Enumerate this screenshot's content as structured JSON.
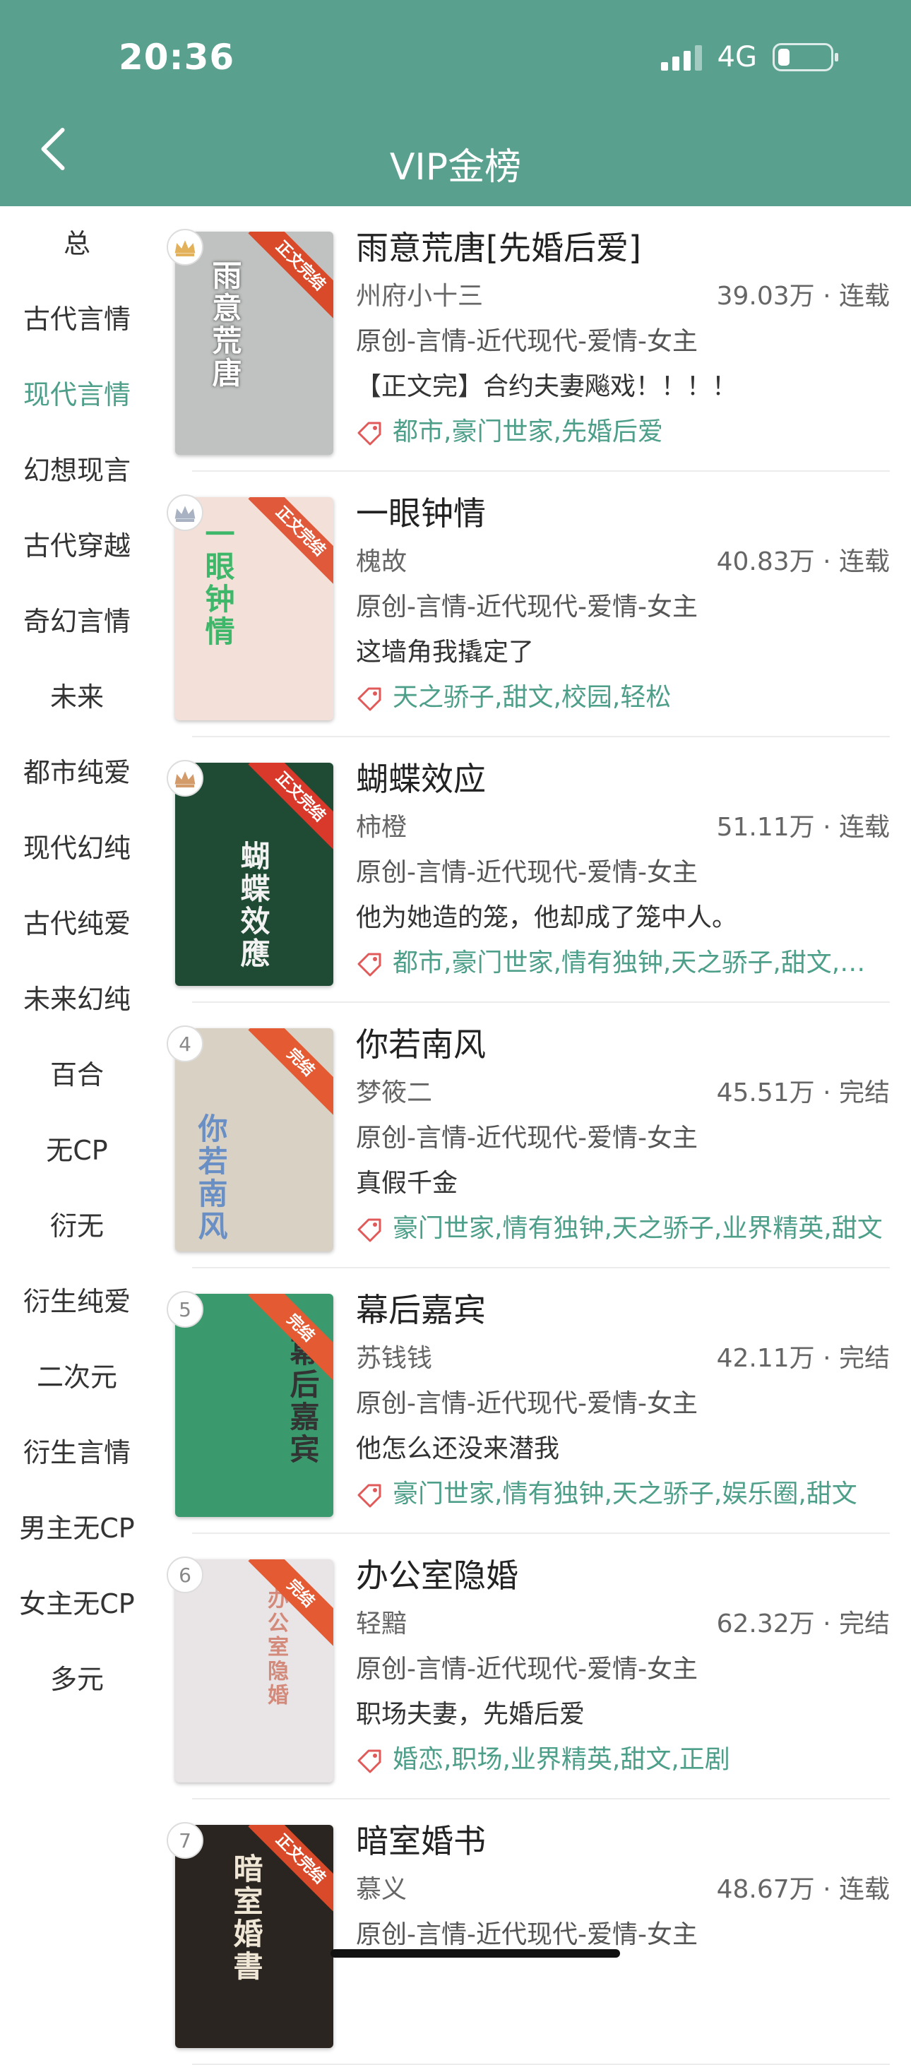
{
  "status": {
    "time": "20:36",
    "network": "4G"
  },
  "header": {
    "title": "VIP金榜"
  },
  "sidebar": {
    "items": [
      {
        "label": "总"
      },
      {
        "label": "古代言情"
      },
      {
        "label": "现代言情"
      },
      {
        "label": "幻想现言"
      },
      {
        "label": "古代穿越"
      },
      {
        "label": "奇幻言情"
      },
      {
        "label": "未来"
      },
      {
        "label": "都市纯爱"
      },
      {
        "label": "现代幻纯"
      },
      {
        "label": "古代纯爱"
      },
      {
        "label": "未来幻纯"
      },
      {
        "label": "百合"
      },
      {
        "label": "无CP"
      },
      {
        "label": "衍无"
      },
      {
        "label": "衍生纯爱"
      },
      {
        "label": "二次元"
      },
      {
        "label": "衍生言情"
      },
      {
        "label": "男主无CP"
      },
      {
        "label": "女主无CP"
      },
      {
        "label": "多元"
      }
    ],
    "active_index": 2
  },
  "books": [
    {
      "rank": "1",
      "title": "雨意荒唐[先婚后爱]",
      "author": "州府小十三",
      "stats": "39.03万 · 连载",
      "genre": "原创-言情-近代现代-爱情-女主",
      "intro": "【正文完】合约夫妻飚戏！！！！",
      "tags": "都市,豪门世家,先婚后爱",
      "ribbon": "正文完结",
      "cover_text": "雨意荒唐",
      "cover_bg": "#bfc2c0",
      "ribbon_color": "#d94a2a"
    },
    {
      "rank": "2",
      "title": "一眼钟情",
      "author": "槐故",
      "stats": "40.83万 · 连载",
      "genre": "原创-言情-近代现代-爱情-女主",
      "intro": "这墙角我撬定了",
      "tags": "天之骄子,甜文,校园,轻松",
      "ribbon": "正文完结",
      "cover_text": "一眼钟情",
      "cover_bg": "#f3e0d8",
      "ribbon_color": "#e0593a"
    },
    {
      "rank": "3",
      "title": "蝴蝶效应",
      "author": "柿橙",
      "stats": "51.11万 · 连载",
      "genre": "原创-言情-近代现代-爱情-女主",
      "intro": "他为她造的笼，他却成了笼中人。",
      "tags": "都市,豪门世家,情有独钟,天之骄子,甜文,轻松",
      "ribbon": "正文完结",
      "cover_text": "蝴蝶效應",
      "cover_bg": "#1f4a33",
      "ribbon_color": "#d8392b"
    },
    {
      "rank": "4",
      "title": "你若南风",
      "author": "梦筱二",
      "stats": "45.51万 · 完结",
      "genre": "原创-言情-近代现代-爱情-女主",
      "intro": "真假千金",
      "tags": "豪门世家,情有独钟,天之骄子,业界精英,甜文",
      "ribbon": "完结",
      "cover_text": "你若南风",
      "cover_bg": "#d9d2c4",
      "ribbon_color": "#e35a33"
    },
    {
      "rank": "5",
      "title": "幕后嘉宾",
      "author": "苏钱钱",
      "stats": "42.11万 · 完结",
      "genre": "原创-言情-近代现代-爱情-女主",
      "intro": "他怎么还没来潜我",
      "tags": "豪门世家,情有独钟,天之骄子,娱乐圈,甜文",
      "ribbon": "完结",
      "cover_text": "幕后嘉宾",
      "cover_bg": "#3a9a6e",
      "ribbon_color": "#e35a33"
    },
    {
      "rank": "6",
      "title": "办公室隐婚",
      "author": "轻黯",
      "stats": "62.32万 · 完结",
      "genre": "原创-言情-近代现代-爱情-女主",
      "intro": "职场夫妻，先婚后爱",
      "tags": "婚恋,职场,业界精英,甜文,正剧",
      "ribbon": "完结",
      "cover_text": "办公室隐婚",
      "cover_bg": "#e9e4e6",
      "ribbon_color": "#e35a33"
    },
    {
      "rank": "7",
      "title": "暗室婚书",
      "author": "慕义",
      "stats": "48.67万 · 连载",
      "genre": "原创-言情-近代现代-爱情-女主",
      "intro": "",
      "tags": "",
      "ribbon": "正文完结",
      "cover_text": "暗室婚書",
      "cover_bg": "#2a2520",
      "ribbon_color": "#d94a2a"
    }
  ],
  "colors": {
    "header_bg": "#5aa08f",
    "accent": "#4e9f8a"
  },
  "icons": {
    "back": "chevron-left-icon",
    "tag": "tag-icon",
    "rank_top3": "crown-icon"
  }
}
